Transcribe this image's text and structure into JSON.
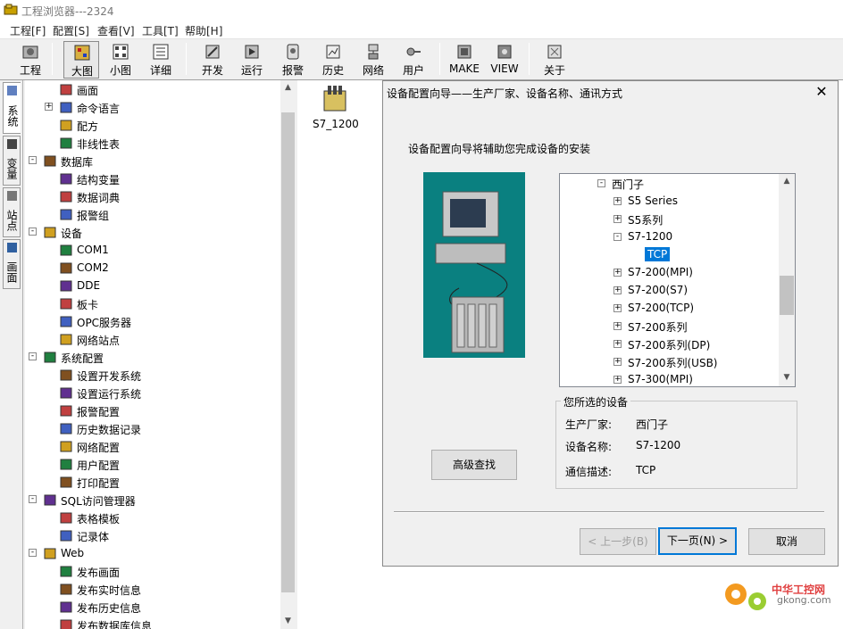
{
  "window": {
    "title": "工程浏览器---2324"
  },
  "menu": [
    "工程[F]",
    "配置[S]",
    "查看[V]",
    "工具[T]",
    "帮助[H]"
  ],
  "toolbar": [
    {
      "label": "工程",
      "icon": "project-icon"
    },
    {
      "label": "大图",
      "icon": "large-icon-view-icon",
      "active": true
    },
    {
      "label": "小图",
      "icon": "small-icon-view-icon"
    },
    {
      "label": "详细",
      "icon": "detail-view-icon"
    },
    {
      "label": "开发",
      "icon": "develop-icon"
    },
    {
      "label": "运行",
      "icon": "run-icon"
    },
    {
      "label": "报警",
      "icon": "alarm-icon"
    },
    {
      "label": "历史",
      "icon": "history-icon"
    },
    {
      "label": "网络",
      "icon": "network-icon"
    },
    {
      "label": "用户",
      "icon": "user-icon"
    },
    {
      "label": "MAKE",
      "icon": "make-icon"
    },
    {
      "label": "VIEW",
      "icon": "view-icon"
    },
    {
      "label": "关于",
      "icon": "about-icon"
    }
  ],
  "vtabs": [
    "系统",
    "变量",
    "站点",
    "画面"
  ],
  "tree": [
    {
      "label": "画面",
      "level": 2,
      "icon": "screen-icon"
    },
    {
      "label": "命令语言",
      "level": 2,
      "icon": "command-icon",
      "expander": "+"
    },
    {
      "label": "配方",
      "level": 2,
      "icon": "recipe-icon"
    },
    {
      "label": "非线性表",
      "level": 2,
      "icon": "table-icon"
    },
    {
      "label": "数据库",
      "level": 1,
      "icon": "database-icon",
      "expander": "-"
    },
    {
      "label": "结构变量",
      "level": 2,
      "icon": "struct-icon"
    },
    {
      "label": "数据词典",
      "level": 2,
      "icon": "dictionary-icon"
    },
    {
      "label": "报警组",
      "level": 2,
      "icon": "alarm-group-icon"
    },
    {
      "label": "设备",
      "level": 1,
      "icon": "device-icon",
      "expander": "-"
    },
    {
      "label": "COM1",
      "level": 2,
      "icon": "com-port-icon"
    },
    {
      "label": "COM2",
      "level": 2,
      "icon": "com-port-icon"
    },
    {
      "label": "DDE",
      "level": 2,
      "icon": "dde-icon"
    },
    {
      "label": "板卡",
      "level": 2,
      "icon": "board-icon"
    },
    {
      "label": "OPC服务器",
      "level": 2,
      "icon": "opc-icon"
    },
    {
      "label": "网络站点",
      "level": 2,
      "icon": "network-station-icon"
    },
    {
      "label": "系统配置",
      "level": 1,
      "icon": "tools-icon",
      "expander": "-"
    },
    {
      "label": "设置开发系统",
      "level": 2,
      "icon": "dev-settings-icon"
    },
    {
      "label": "设置运行系统",
      "level": 2,
      "icon": "run-settings-icon"
    },
    {
      "label": "报警配置",
      "level": 2,
      "icon": "alarm-config-icon"
    },
    {
      "label": "历史数据记录",
      "level": 2,
      "icon": "history-record-icon"
    },
    {
      "label": "网络配置",
      "level": 2,
      "icon": "network-config-icon"
    },
    {
      "label": "用户配置",
      "level": 2,
      "icon": "user-config-icon"
    },
    {
      "label": "打印配置",
      "level": 2,
      "icon": "print-icon"
    },
    {
      "label": "SQL访问管理器",
      "level": 1,
      "icon": "sql-icon",
      "expander": "-"
    },
    {
      "label": "表格模板",
      "level": 2,
      "icon": "template-icon"
    },
    {
      "label": "记录体",
      "level": 2,
      "icon": "record-icon"
    },
    {
      "label": "Web",
      "level": 1,
      "icon": "folder-icon",
      "expander": "-"
    },
    {
      "label": "发布画面",
      "level": 2,
      "icon": "publish-screen-icon"
    },
    {
      "label": "发布实时信息",
      "level": 2,
      "icon": "publish-realtime-icon"
    },
    {
      "label": "发布历史信息",
      "level": 2,
      "icon": "publish-history-icon"
    },
    {
      "label": "发布数据库信息",
      "level": 2,
      "icon": "publish-db-icon"
    }
  ],
  "device_list": [
    {
      "label": "S7_1200"
    }
  ],
  "dialog": {
    "title": "设备配置向导——生产厂家、设备名称、通讯方式",
    "close": "✕",
    "description": "设备配置向导将辅助您完成设备的安装",
    "tree": [
      {
        "label": "西门子",
        "expander": "-",
        "level": 0
      },
      {
        "label": "S5 Series",
        "expander": "+",
        "level": 1
      },
      {
        "label": "S5系列",
        "expander": "+",
        "level": 1
      },
      {
        "label": "S7-1200",
        "expander": "-",
        "level": 1
      },
      {
        "label": "TCP",
        "level": 2,
        "selected": true
      },
      {
        "label": "S7-200(MPI)",
        "expander": "+",
        "level": 1
      },
      {
        "label": "S7-200(S7)",
        "expander": "+",
        "level": 1
      },
      {
        "label": "S7-200(TCP)",
        "expander": "+",
        "level": 1
      },
      {
        "label": "S7-200系列",
        "expander": "+",
        "level": 1
      },
      {
        "label": "S7-200系列(DP)",
        "expander": "+",
        "level": 1
      },
      {
        "label": "S7-200系列(USB)",
        "expander": "+",
        "level": 1
      },
      {
        "label": "S7-300(MPI)",
        "expander": "+",
        "level": 1
      }
    ],
    "selected_group": {
      "title": "您所选的设备",
      "rows": [
        {
          "label": "生产厂家:",
          "value": "西门子"
        },
        {
          "label": "设备名称:",
          "value": "S7-1200"
        },
        {
          "label": "通信描述:",
          "value": "TCP"
        }
      ]
    },
    "advanced_search": "高级查找",
    "prev": "< 上一步(B)",
    "next": "下一页(N) >",
    "cancel": "取消"
  },
  "watermark": {
    "line1": "中华工控网",
    "line2": "gkong.com"
  },
  "colors": {
    "selection": "#0078d7",
    "illustration_bg": "#0a8080"
  }
}
